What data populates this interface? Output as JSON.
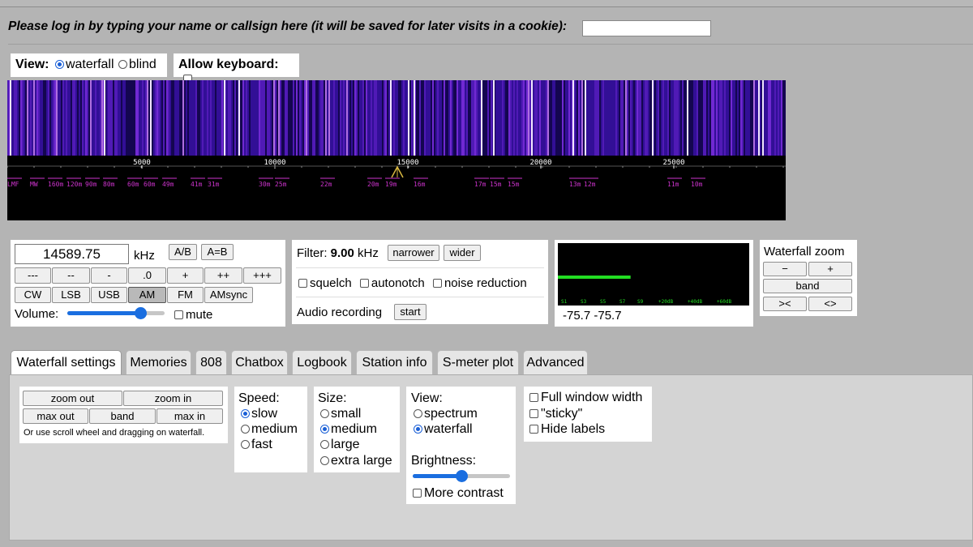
{
  "login": {
    "prompt": "Please log in by typing your name or callsign here (it will be saved for later visits in a cookie):",
    "value": ""
  },
  "view": {
    "label": "View:",
    "waterfall": "waterfall",
    "blind": "blind",
    "selected": "waterfall"
  },
  "keyboard": {
    "label": "Allow keyboard:",
    "checked": false
  },
  "waterfall_display": {
    "scale_ticks": [
      "5000",
      "10000",
      "15000",
      "20000",
      "25000"
    ],
    "band_labels": [
      "LMF",
      "MW",
      "160m",
      "120m",
      "90m",
      "80m",
      "60m",
      "60m",
      "49m",
      "41m",
      "31m",
      "30m",
      "25m",
      "22m",
      "20m",
      "19m",
      "16m",
      "17m",
      "15m",
      "15m",
      "13m",
      "12m",
      "11m",
      "10m"
    ]
  },
  "tuning": {
    "frequency": "14589.75",
    "unit": "kHz",
    "ab_label": "A/B",
    "aeqb_label": "A=B",
    "steps": [
      "---",
      "--",
      "-",
      ".0",
      "+",
      "++",
      "+++"
    ],
    "modes": [
      "CW",
      "LSB",
      "USB",
      "AM",
      "FM",
      "AMsync"
    ],
    "active_mode": "AM",
    "volume_label": "Volume:",
    "volume_level": 0.75,
    "mute_label": "mute"
  },
  "filter": {
    "label": "Filter:",
    "value": "9.00",
    "unit": "kHz",
    "narrower": "narrower",
    "wider": "wider",
    "squelch": "squelch",
    "autonotch": "autonotch",
    "noise_reduction": "noise reduction",
    "recording_label": "Audio recording",
    "start": "start"
  },
  "smeter": {
    "scale": [
      "S1",
      "S3",
      "S5",
      "S7",
      "S9",
      "+20dB",
      "+40dB",
      "+60dB"
    ],
    "reading": "-75.7 -75.7",
    "level": 0.38
  },
  "wf_zoom": {
    "title": "Waterfall zoom",
    "minus": "−",
    "plus": "+",
    "band": "band",
    "left": "><",
    "right": "<>"
  },
  "tabs": [
    "Waterfall settings",
    "Memories",
    "808",
    "Chatbox",
    "Logbook",
    "Station info",
    "S-meter plot",
    "Advanced"
  ],
  "active_tab": "Waterfall settings",
  "settings": {
    "zoom_out": "zoom out",
    "zoom_in": "zoom in",
    "max_out": "max out",
    "band": "band",
    "max_in": "max in",
    "hint": "Or use scroll wheel and dragging on waterfall.",
    "speed": {
      "label": "Speed:",
      "options": [
        "slow",
        "medium",
        "fast"
      ],
      "selected": "slow"
    },
    "size": {
      "label": "Size:",
      "options": [
        "small",
        "medium",
        "large",
        "extra large"
      ],
      "selected": "medium"
    },
    "view": {
      "label": "View:",
      "options": [
        "spectrum",
        "waterfall"
      ],
      "selected": "waterfall"
    },
    "brightness_label": "Brightness:",
    "brightness_level": 0.5,
    "more_contrast": "More contrast",
    "full_width": "Full window width",
    "sticky": "\"sticky\"",
    "hide_labels": "Hide labels"
  },
  "colors": {
    "accent": "#1a6ee0",
    "waterfall_bg": "#000000",
    "smeter_bar": "#22dd22",
    "band_label": "#cc33cc",
    "passband_marker": "#d7b640"
  }
}
